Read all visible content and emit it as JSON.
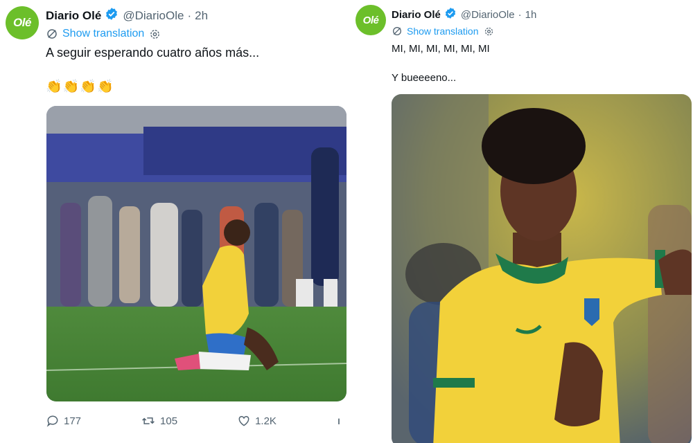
{
  "left_tweet": {
    "avatar_text": "Olé",
    "name": "Diario Olé",
    "handle": "@DiarioOle",
    "separator": "·",
    "time": "2h",
    "show_translation": "Show translation",
    "text": "A seguir esperando cuatro años más...",
    "emojis": "👏👏👏👏",
    "stats": {
      "replies": "177",
      "retweets": "105",
      "likes": "1.2K"
    }
  },
  "right_tweet": {
    "avatar_text": "Olé",
    "name": "Diario Olé",
    "handle": "@DiarioOle",
    "separator": "·",
    "time": "1h",
    "show_translation": "Show translation",
    "text_line1": "MI, MI, MI, MI, MI, MI",
    "text_line2": "Y bueeeeno..."
  },
  "colors": {
    "accent": "#1d9bf0",
    "muted": "#536471",
    "brand_green": "#6cbf2a",
    "jersey_yellow": "#f2d13a"
  }
}
